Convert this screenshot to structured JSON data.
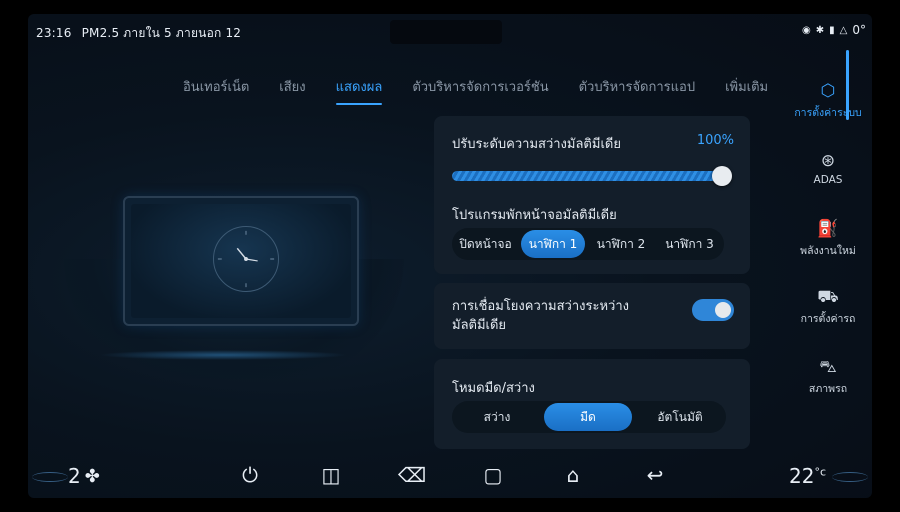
{
  "status": {
    "time": "23:16",
    "air": "PM2.5 ภายใน 5 ภายนอก 12",
    "right_icons": [
      "location-icon",
      "bluetooth-icon",
      "signal-icon",
      "warning-icon"
    ],
    "right_value": "0°"
  },
  "tabs": [
    {
      "label": "อินเทอร์เน็ต"
    },
    {
      "label": "เสียง"
    },
    {
      "label": "แสดงผล",
      "active": true
    },
    {
      "label": "ตัวบริหารจัดการเวอร์ชัน"
    },
    {
      "label": "ตัวบริหารจัดการแอป"
    },
    {
      "label": "เพิ่มเติม"
    }
  ],
  "brightness": {
    "label": "ปรับระดับความสว่างมัลติมีเดีย",
    "value_text": "100%",
    "value": 1.0
  },
  "screensaver": {
    "label": "โปรแกรมพักหน้าจอมัลติมีเดีย",
    "options": [
      "ปิดหน้าจอ",
      "นาฬิกา 1",
      "นาฬิกา 2",
      "นาฬิกา 3"
    ],
    "selected": "นาฬิกา 1"
  },
  "link_brightness": {
    "label_line1": "การเชื่อมโยงความสว่างระหว่าง",
    "label_line2": "มัลติมีเดีย",
    "enabled": true
  },
  "theme": {
    "label": "โหมดมืด/สว่าง",
    "options": [
      "สว่าง",
      "มืด",
      "อัตโนมัติ"
    ],
    "selected": "มืด"
  },
  "sidebar": {
    "items": [
      {
        "label": "การตั้งค่าระบบ",
        "icon": "settings-hex-icon",
        "active": true
      },
      {
        "label": "ADAS",
        "icon": "steering-wheel-icon"
      },
      {
        "label": "พลังงานใหม่",
        "icon": "charging-icon"
      },
      {
        "label": "การตั้งค่ารถ",
        "icon": "car-icon"
      },
      {
        "label": "สภาพรถ",
        "icon": "car-status-icon"
      }
    ]
  },
  "bottom": {
    "fan_level": "2",
    "temperature": "22",
    "temp_unit": "°c",
    "nav_icons": [
      "power-icon",
      "split-screen-icon",
      "clean-icon",
      "square-icon",
      "home-icon",
      "back-icon"
    ]
  },
  "colors": {
    "accent": "#3aa4ff",
    "card": "#131e2a",
    "background": "#09131e"
  }
}
